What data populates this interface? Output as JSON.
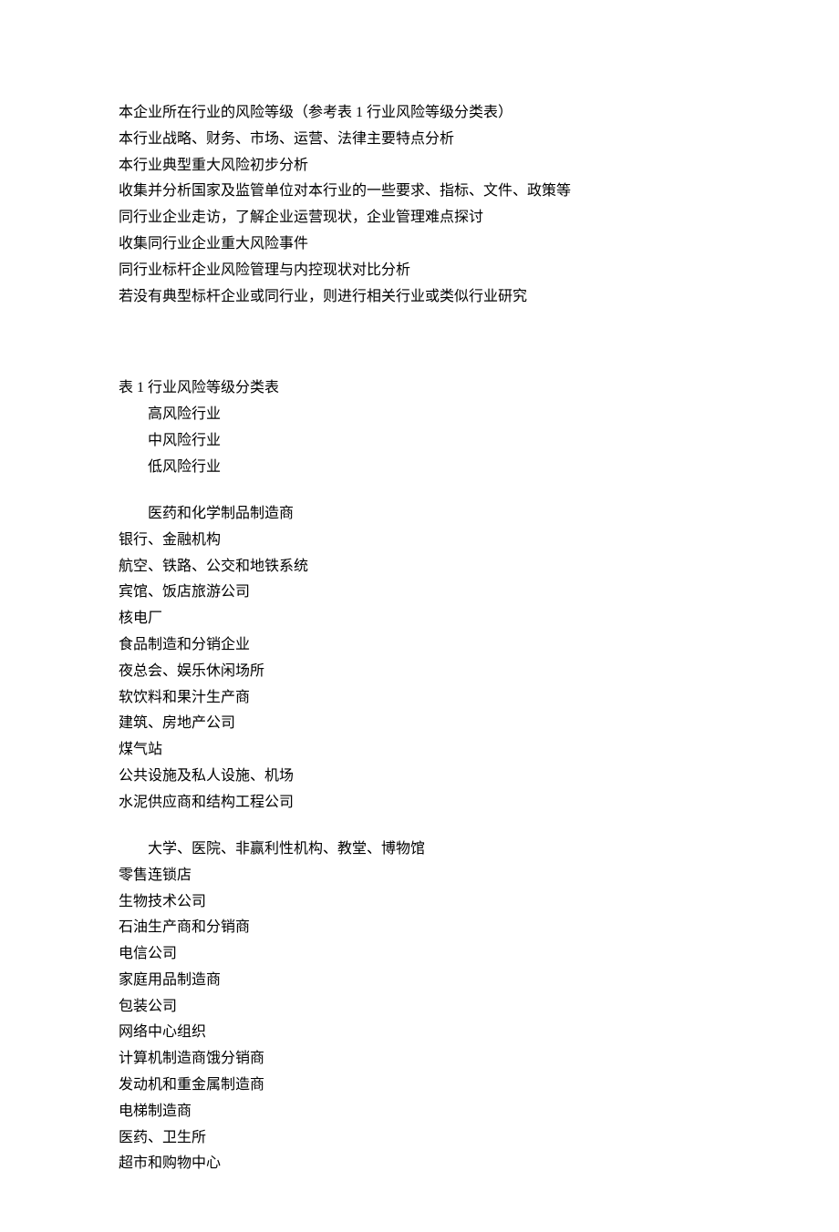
{
  "intro_lines": [
    "本企业所在行业的风险等级（参考表 1 行业风险等级分类表）",
    "本行业战略、财务、市场、运营、法律主要特点分析",
    "本行业典型重大风险初步分析",
    "收集并分析国家及监管单位对本行业的一些要求、指标、文件、政策等",
    "同行业企业走访，了解企业运营现状，企业管理难点探讨",
    "收集同行业企业重大风险事件",
    "同行业标杆企业风险管理与内控现状对比分析",
    "若没有典型标杆企业或同行业，则进行相关行业或类似行业研究"
  ],
  "table_title": "表 1   行业风险等级分类表",
  "risk_levels": [
    "高风险行业",
    "中风险行业",
    "低风险行业"
  ],
  "group1_first": "医药和化学制品制造商",
  "group1_rest": [
    "银行、金融机构",
    "航空、铁路、公交和地铁系统",
    "宾馆、饭店旅游公司",
    "核电厂",
    "食品制造和分销企业",
    "夜总会、娱乐休闲场所",
    "软饮料和果汁生产商",
    "建筑、房地产公司",
    "煤气站",
    "公共设施及私人设施、机场",
    "水泥供应商和结构工程公司"
  ],
  "group2_first": "大学、医院、非赢利性机构、教堂、博物馆",
  "group2_rest": [
    "零售连锁店",
    "生物技术公司",
    "石油生产商和分销商",
    "电信公司",
    "家庭用品制造商",
    "包装公司",
    "网络中心组织",
    "计算机制造商饿分销商",
    "发动机和重金属制造商",
    "电梯制造商",
    "医药、卫生所",
    "超市和购物中心"
  ]
}
